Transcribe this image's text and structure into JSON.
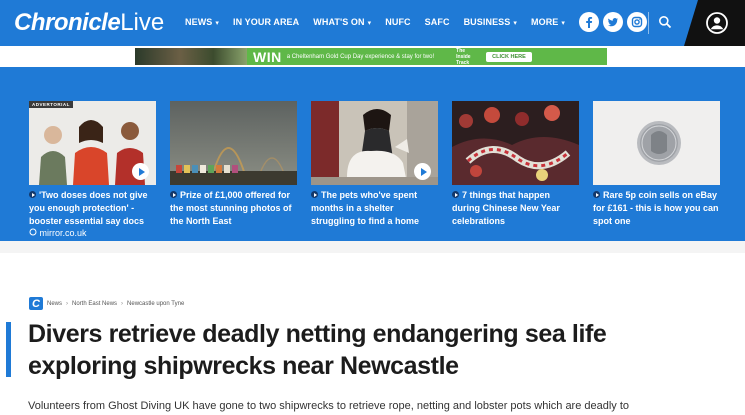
{
  "header": {
    "logo_bold": "Chronicle",
    "logo_light": "Live",
    "nav": [
      {
        "label": "NEWS",
        "caret": true
      },
      {
        "label": "IN YOUR AREA",
        "caret": false
      },
      {
        "label": "WHAT'S ON",
        "caret": true
      },
      {
        "label": "NUFC",
        "caret": false
      },
      {
        "label": "SAFC",
        "caret": false
      },
      {
        "label": "BUSINESS",
        "caret": true
      },
      {
        "label": "MORE",
        "caret": true
      }
    ],
    "social_icons": [
      "facebook-icon",
      "twitter-icon",
      "instagram-icon"
    ],
    "search_icon": "search-icon",
    "account_icon": "account-icon"
  },
  "promo": {
    "win": "WIN",
    "text": "a Cheltenham Gold Cup Day experience & stay for two!",
    "brand": "The Inside Track",
    "cta": "CLICK HERE"
  },
  "cards": [
    {
      "title": "'Two doses does not give you enough protection' - booster essential say docs",
      "source": "mirror.co.uk",
      "ad_label": "ADVERTORIAL",
      "play": true
    },
    {
      "title": "Prize of £1,000 offered for the most stunning photos of the North East",
      "source": "",
      "ad_label": "",
      "play": false
    },
    {
      "title": "The pets who've spent months in a shelter struggling to find a home",
      "source": "",
      "ad_label": "",
      "play": true
    },
    {
      "title": "7 things that happen during Chinese New Year celebrations",
      "source": "",
      "ad_label": "",
      "play": false
    },
    {
      "title": "Rare 5p coin sells on eBay for £161 - this is how you can spot one",
      "source": "",
      "ad_label": "",
      "play": false
    }
  ],
  "breadcrumb": [
    "News",
    "North East News",
    "Newcastle upon Tyne"
  ],
  "article": {
    "headline": "Divers retrieve deadly netting endangering sea life exploring shipwrecks near Newcastle",
    "standfirst": "Volunteers from Ghost Diving UK have gone to two shipwrecks to retrieve rope, netting and lobster pots which are deadly to"
  },
  "colors": {
    "brand_blue": "#1f7ad6",
    "promo_green": "#5fb848",
    "headline": "#1c1c1c"
  }
}
